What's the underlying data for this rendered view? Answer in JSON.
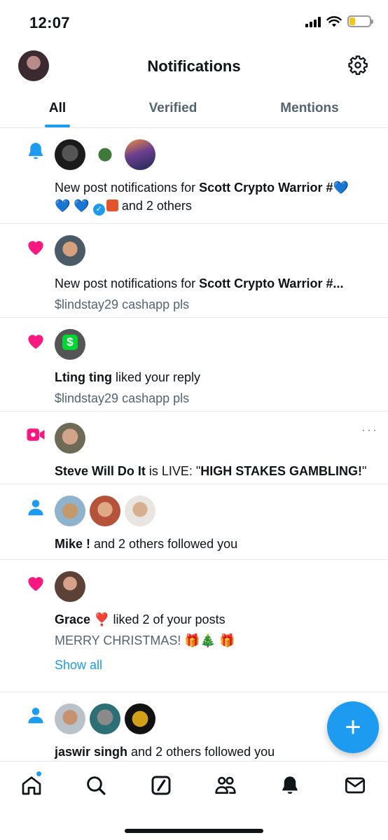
{
  "status_bar": {
    "time": "12:07",
    "battery_level": 0.3
  },
  "header": {
    "title": "Notifications"
  },
  "tabs": [
    {
      "label": "All",
      "active": true
    },
    {
      "label": "Verified",
      "active": false
    },
    {
      "label": "Mentions",
      "active": false
    }
  ],
  "notifications": [
    {
      "icon": "bell-icon",
      "line_prefix": "New post notifications for ",
      "name": "Scott Crypto Warrior #",
      "line_emoji": "💙",
      "line2_emoji": "💙 💙",
      "line_suffix": " and 2 others"
    },
    {
      "icon": "heart-icon",
      "line_prefix": "New post notifications for ",
      "name": "Scott Crypto Warrior #...",
      "sub": "$lindstay29 cashapp pls"
    },
    {
      "icon": "heart-icon",
      "name": "Lting ting",
      "line_suffix": " liked your reply",
      "sub": "$lindstay29 cashapp pls"
    },
    {
      "icon": "live-video-icon",
      "name": "Steve Will Do It",
      "line_middle": " is LIVE: \"",
      "live_title": "HIGH STAKES GAMBLING!",
      "line_end": "\"",
      "more": "···"
    },
    {
      "icon": "person-icon",
      "name": "Mike !",
      "line_suffix": " and 2 others followed you"
    },
    {
      "icon": "heart-icon",
      "name": "Grace",
      "name_emoji": "❣️",
      "line_suffix": " liked 2 of your posts",
      "sub": "MERRY CHRISTMAS! 🎁🎄 🎁",
      "show_all": "Show all"
    },
    {
      "icon": "person-icon",
      "name": "jaswir singh",
      "line_suffix": " and 2 others followed you"
    }
  ],
  "fab": {
    "label": "+"
  },
  "colors": {
    "accent": "#1d9bf0",
    "heart": "#f91880",
    "text": "#0f1419",
    "secondary": "#536471"
  }
}
